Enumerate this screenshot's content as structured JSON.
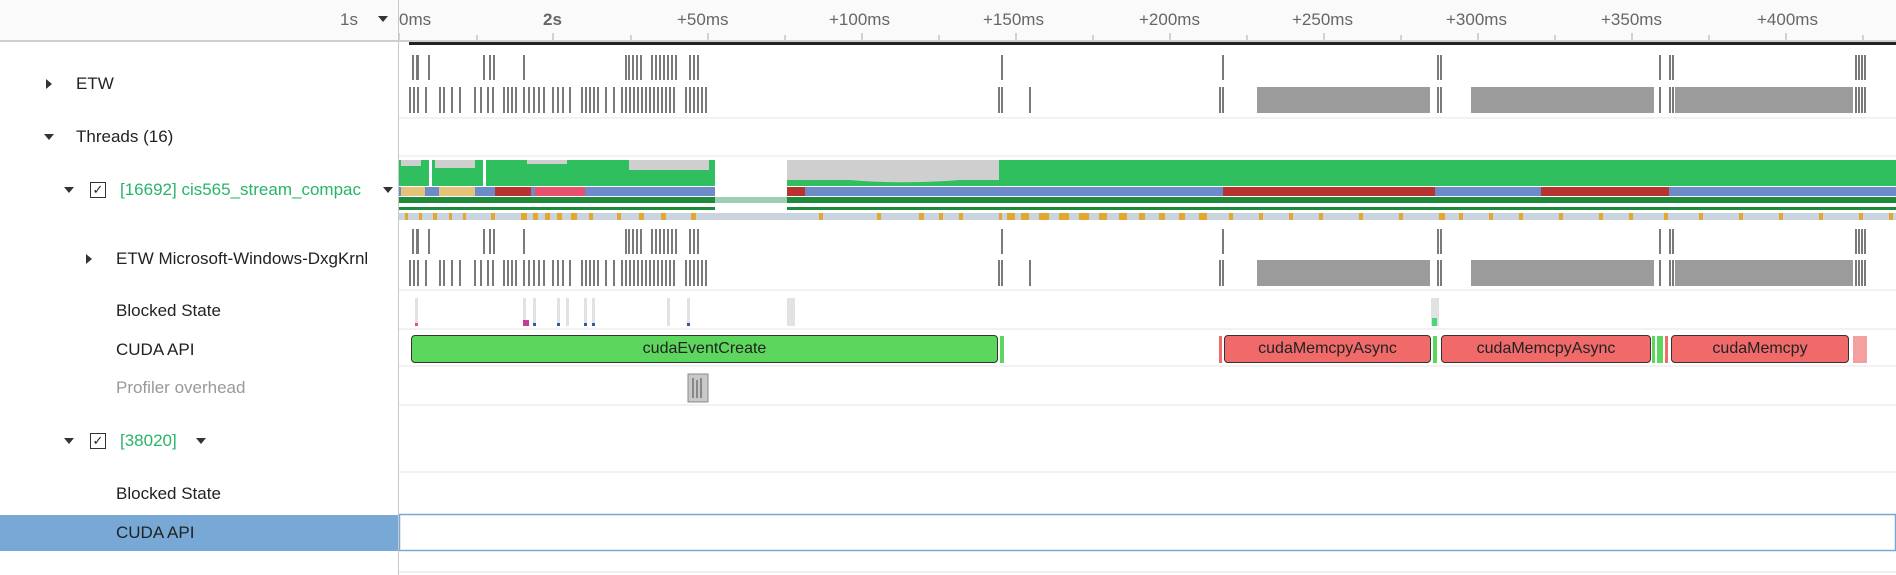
{
  "timeline": {
    "zoom_label": "1s",
    "ticks": [
      "0ms",
      "2s",
      "+50ms",
      "+100ms",
      "+150ms",
      "+200ms",
      "+250ms",
      "+300ms",
      "+350ms",
      "+400ms"
    ]
  },
  "rows": {
    "etw": "ETW",
    "threads": "Threads (16)",
    "thread1": "[16692] cis565_stream_compac",
    "etw_dxg": "ETW Microsoft-Windows-DxgKrnl",
    "blocked1": "Blocked State",
    "cuda1": "CUDA API",
    "profiler": "Profiler overhead",
    "thread2": "[38020]",
    "blocked2": "Blocked State",
    "cuda2": "CUDA API"
  },
  "checkmark": "✓",
  "api_blocks": {
    "b1": "cudaEventCreate",
    "b2": "cudaMemcpyAsync",
    "b3": "cudaMemcpyAsync",
    "b4": "cudaMemcpy"
  },
  "colors": {
    "cpu_green": "#2fbf5f",
    "idle_gray": "#cfcfcf",
    "state_blue": "#6d8bc9",
    "state_red": "#b83232",
    "event_orange": "#e5a62d",
    "api_ok": "#5dd65d",
    "api_bad": "#f06a6a",
    "selection": "#78a9d6"
  }
}
